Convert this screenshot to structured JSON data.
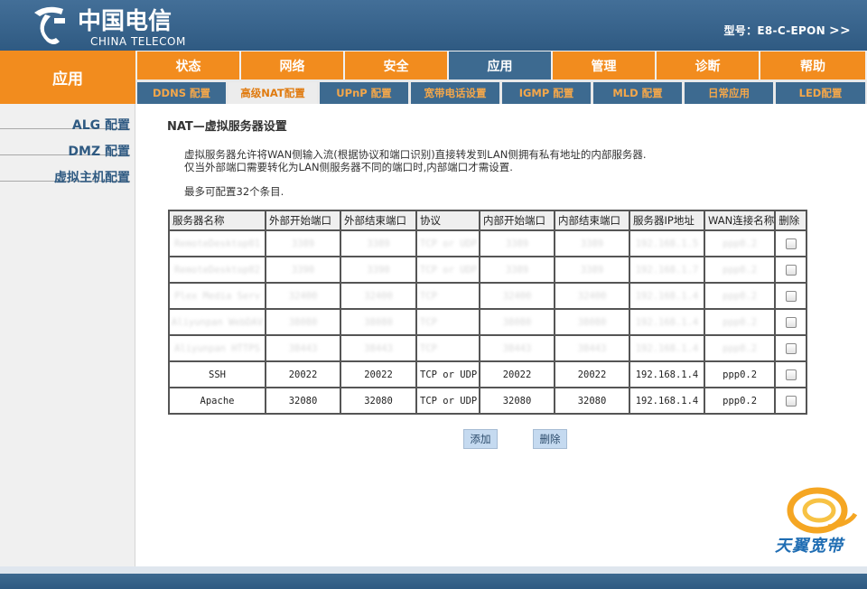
{
  "header": {
    "logo_cn": "中国电信",
    "logo_en": "CHINA TELECOM",
    "model_label": "型号：E8-C-EPON",
    "model_arrows": ">>"
  },
  "section_label": "应用",
  "tabs": [
    "状态",
    "网络",
    "安全",
    "应用",
    "管理",
    "诊断",
    "帮助"
  ],
  "active_tab": "应用",
  "subtabs": [
    "DDNS 配置",
    "高级NAT配置",
    "UPnP 配置",
    "宽带电话设置",
    "IGMP 配置",
    "MLD 配置",
    "日常应用",
    "LED配置"
  ],
  "active_subtab": "高级NAT配置",
  "sidebar": [
    "ALG 配置",
    "DMZ 配置",
    "虚拟主机配置"
  ],
  "page_title": "NAT—虚拟服务器设置",
  "desc1": "虚拟服务器允许将WAN侧输入流(根据协议和端口识别)直接转发到LAN侧拥有私有地址的内部服务器.",
  "desc2": "仅当外部端口需要转化为LAN侧服务器不同的端口时,内部端口才需设置.",
  "desc3": "最多可配置32个条目.",
  "table": {
    "headers": [
      "服务器名称",
      "外部开始端口",
      "外部结束端口",
      "协议",
      "内部开始端口",
      "内部结束端口",
      "服务器IP地址",
      "WAN连接名称",
      "删除"
    ],
    "rows": [
      [
        "RemoteDesktop01",
        "3389",
        "3389",
        "TCP or UDP",
        "3389",
        "3389",
        "192.168.1.5",
        "ppp0.2",
        ""
      ],
      [
        "RemoteDesktop02",
        "3390",
        "3390",
        "TCP or UDP",
        "3389",
        "3389",
        "192.168.1.7",
        "ppp0.2",
        ""
      ],
      [
        "Plex Media Serv",
        "32400",
        "32400",
        "TCP",
        "32400",
        "32400",
        "192.168.1.4",
        "ppp0.2",
        ""
      ],
      [
        "Aliyunpan WebDAV",
        "38080",
        "38080",
        "TCP",
        "38080",
        "38080",
        "192.168.1.4",
        "ppp0.2",
        ""
      ],
      [
        "Aliyunpan HTTPS",
        "38443",
        "38443",
        "TCP",
        "38443",
        "38443",
        "192.168.1.4",
        "ppp0.2",
        ""
      ],
      [
        "SSH",
        "20022",
        "20022",
        "TCP or UDP",
        "20022",
        "20022",
        "192.168.1.4",
        "ppp0.2",
        ""
      ],
      [
        "Apache",
        "32080",
        "32080",
        "TCP or UDP",
        "32080",
        "32080",
        "192.168.1.4",
        "ppp0.2",
        ""
      ]
    ],
    "blurred_rows": 5
  },
  "buttons": {
    "add": "添加",
    "delete": "删除"
  },
  "brand_text": "天翼宽带",
  "colors": {
    "orange": "#f28c1e",
    "blue": "#3d6a90",
    "text_blue": "#2f5a82"
  }
}
